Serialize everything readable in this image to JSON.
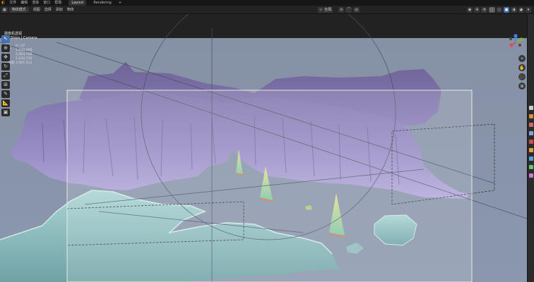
{
  "menubar": {
    "items": [
      "文件",
      "编辑",
      "渲染",
      "窗口",
      "帮助"
    ],
    "workspace_tabs": [
      "Layout",
      "Rendering"
    ],
    "add_tab": "+"
  },
  "header": {
    "mode": "物体模式",
    "menus": [
      "视图",
      "选择",
      "添加",
      "物体"
    ],
    "transform_orientation": "全局",
    "overlay_toggle": "▾"
  },
  "toolbar": {
    "tools": [
      {
        "name": "select-tool-icon",
        "glyph": "↖",
        "active": true
      },
      {
        "name": "cursor-tool-icon",
        "glyph": "⊕",
        "active": false
      },
      {
        "name": "move-tool-icon",
        "glyph": "✥",
        "active": false
      },
      {
        "name": "rotate-tool-icon",
        "glyph": "↻",
        "active": false
      },
      {
        "name": "scale-tool-icon",
        "glyph": "⤢",
        "active": false
      },
      {
        "name": "transform-tool-icon",
        "glyph": "⊞",
        "active": false
      },
      {
        "name": "annotate-tool-icon",
        "glyph": "✎",
        "active": false
      },
      {
        "name": "measure-tool-icon",
        "glyph": "📐",
        "active": false
      },
      {
        "name": "add-cube-tool-icon",
        "glyph": "▣",
        "active": false
      }
    ]
  },
  "viewport_overlay": {
    "view_name": "摄像机透视",
    "collection": "(1) Ships | Camera",
    "stats": [
      {
        "label": "物体",
        "value": "0 / 47"
      },
      {
        "label": "顶点",
        "value": "1,034,408"
      },
      {
        "label": "边",
        "value": "2,064,768"
      },
      {
        "label": "面",
        "value": "1,030,736"
      },
      {
        "label": "三角面",
        "value": "2,061,512"
      }
    ]
  },
  "gizmo": {
    "axes": [
      "X",
      "Y",
      "Z"
    ],
    "colors": {
      "x": "#e04a5a",
      "y": "#7db63b",
      "z": "#3f86e8"
    }
  },
  "nav_buttons": [
    "+",
    "✋",
    "🎥",
    "⊞"
  ],
  "colors": {
    "sky": "#8896ad",
    "purple_terrain": "#8a7db8",
    "cyan_terrain": "#9cc6c6",
    "camera_frame": "#e8e8e8",
    "accent": "#4772b3"
  }
}
